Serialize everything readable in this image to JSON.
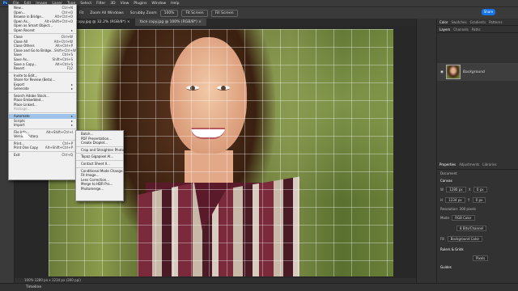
{
  "menubar": {
    "logo": "Ps",
    "items": [
      "File",
      "Edit",
      "Image",
      "Layer",
      "Type",
      "Select",
      "Filter",
      "3D",
      "View",
      "Plugins",
      "Window",
      "Help"
    ]
  },
  "options": {
    "fit": "Fit",
    "zoom_all": "Zoom All Windows",
    "scrubby": "Scrubby Zoom",
    "zoom_pct": "100%",
    "fit_screen": "Fit Screen",
    "fill_screen": "Fill Screen",
    "share": "Share"
  },
  "tabs": [
    {
      "label": "test copy.jpg @ 32.2% (RGB/8*) ×"
    },
    {
      "label": "face copy.jpg @ 100% (RGB/8*) ×"
    }
  ],
  "file_menu": [
    {
      "label": "New...",
      "sc": "Ctrl+N"
    },
    {
      "label": "Open...",
      "sc": "Ctrl+O"
    },
    {
      "label": "Browse in Bridge...",
      "sc": "Alt+Ctrl+O"
    },
    {
      "label": "Open As...",
      "sc": "Alt+Shift+Ctrl+O"
    },
    {
      "label": "Open as Smart Object...",
      "sc": ""
    },
    {
      "label": "Open Recent",
      "sc": "▸"
    },
    {
      "label": "Close",
      "sc": "Ctrl+W"
    },
    {
      "label": "Close All",
      "sc": "Alt+Ctrl+W"
    },
    {
      "label": "Close Others",
      "sc": "Alt+Ctrl+P"
    },
    {
      "label": "Close and Go to Bridge...",
      "sc": "Shift+Ctrl+W"
    },
    {
      "label": "Save",
      "sc": "Ctrl+S"
    },
    {
      "label": "Save As...",
      "sc": "Shift+Ctrl+S"
    },
    {
      "label": "Save a Copy...",
      "sc": "Alt+Ctrl+S"
    },
    {
      "label": "Revert",
      "sc": "F12"
    },
    {
      "label": "Invite to Edit...",
      "sc": ""
    },
    {
      "label": "Share for Review (Beta)...",
      "sc": ""
    },
    {
      "label": "Export",
      "sc": "▸"
    },
    {
      "label": "Generate",
      "sc": "▸"
    },
    {
      "label": "Search Adobe Stock...",
      "sc": ""
    },
    {
      "label": "Place Embedded...",
      "sc": ""
    },
    {
      "label": "Place Linked...",
      "sc": ""
    },
    {
      "label": "Package...",
      "sc": ""
    },
    {
      "label": "Automate",
      "sc": "▸"
    },
    {
      "label": "Scripts",
      "sc": "▸"
    },
    {
      "label": "Import",
      "sc": "▸"
    },
    {
      "label": "File Info...",
      "sc": "Alt+Shift+Ctrl+I"
    },
    {
      "label": "Version History",
      "sc": ""
    },
    {
      "label": "Print...",
      "sc": "Ctrl+P"
    },
    {
      "label": "Print One Copy",
      "sc": "Alt+Shift+Ctrl+P"
    },
    {
      "label": "Exit",
      "sc": "Ctrl+Q"
    }
  ],
  "automate_menu": [
    "Batch...",
    "PDF Presentation...",
    "Create Droplet...",
    "Crop and Straighten Photos",
    "Topaz Gigapixel AI...",
    "Contact Sheet II...",
    "Conditional Mode Change...",
    "Fit Image...",
    "Lens Correction...",
    "Merge to HDR Pro...",
    "Photomerge..."
  ],
  "panels": {
    "top_tabs": [
      "Color",
      "Swatches",
      "Gradients",
      "Patterns"
    ],
    "layer_tabs": [
      "Layers",
      "Channels",
      "Paths"
    ],
    "layer_name": "Background",
    "props_tabs": [
      "Properties",
      "Adjustments",
      "Libraries"
    ],
    "doc": "Document",
    "canvas": "Canvas",
    "w": "1280 px",
    "h": "1234 px",
    "x": "0 px",
    "y": "0 px",
    "resolution": "Resolution: 300 pixels",
    "mode_label": "Mode",
    "mode": "RGB Color",
    "depth": "8 Bits/Channel",
    "fill_label": "Fill",
    "fill": "Background Color",
    "rulers": "Rulers & Grids",
    "units": "Pixels",
    "guides": "Guides"
  },
  "status": "100%  1280 px x 1234 px (300 ppi)",
  "timeline": "Timeline"
}
